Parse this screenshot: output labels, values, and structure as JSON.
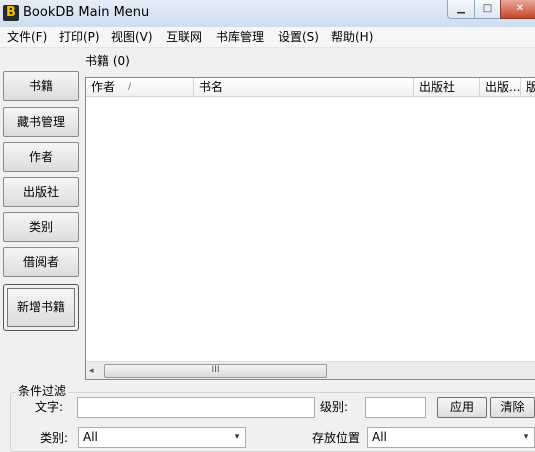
{
  "window": {
    "title": "BookDB Main Menu",
    "app_icon_letter": "B",
    "minimize_glyph": "▁",
    "maximize_glyph": "□",
    "close_glyph": "✕"
  },
  "menu": [
    "文件(F)",
    "打印(P)",
    "视图(V)",
    "互联网",
    "书库管理",
    "设置(S)",
    "帮助(H)"
  ],
  "sidebar": {
    "items": [
      "书籍",
      "藏书管理",
      "作者",
      "出版社",
      "类别",
      "借阅者"
    ],
    "add_button": "新增书籍"
  },
  "list": {
    "header": "书籍 (0)",
    "columns": [
      "作者",
      "书名",
      "出版社",
      "出版...",
      "版"
    ],
    "sort_glyph": "/",
    "scroll_left_glyph": "◂",
    "scroll_thumb_glyph": "III"
  },
  "filter": {
    "legend": "条件过滤",
    "text_label": "文字:",
    "text_value": "",
    "level_label": "级别:",
    "level_value": "",
    "apply_label": "应用",
    "clear_label": "清除",
    "category_label": "类别:",
    "category_value": "All",
    "location_label": "存放位置",
    "location_value": "All",
    "dropdown_glyph": "▾"
  }
}
